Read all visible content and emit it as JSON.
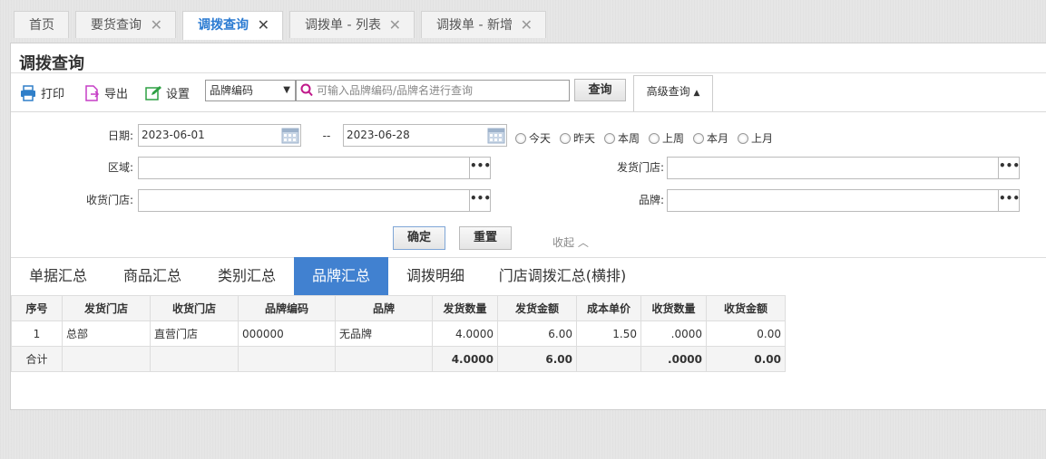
{
  "tabs": [
    {
      "label": "首页",
      "closable": false
    },
    {
      "label": "要货查询",
      "closable": true
    },
    {
      "label": "调拨查询",
      "closable": true,
      "active": true
    },
    {
      "label": "调拨单 - 列表",
      "closable": true
    },
    {
      "label": "调拨单 - 新增",
      "closable": true
    }
  ],
  "page_title": "调拨查询",
  "toolbar": {
    "print": "打印",
    "export": "导出",
    "settings": "设置",
    "search_field": "品牌编码",
    "search_placeholder": "可输入品牌编码/品牌名进行查询",
    "query": "查询",
    "advanced": "高级查询"
  },
  "filters": {
    "date_label": "日期:",
    "date_from": "2023-06-01",
    "date_sep": "--",
    "date_to": "2023-06-28",
    "quick_dates": [
      "今天",
      "昨天",
      "本周",
      "上周",
      "本月",
      "上月"
    ],
    "region_label": "区域:",
    "ship_store_label": "发货门店:",
    "recv_store_label": "收货门店:",
    "brand_label": "品牌:",
    "confirm": "确定",
    "reset": "重置",
    "collapse": "收起"
  },
  "summary_tabs": [
    "单据汇总",
    "商品汇总",
    "类别汇总",
    "品牌汇总",
    "调拨明细",
    "门店调拨汇总(横排)"
  ],
  "active_summary_tab": "品牌汇总",
  "table": {
    "headers": [
      "序号",
      "发货门店",
      "收货门店",
      "品牌编码",
      "品牌",
      "发货数量",
      "发货金额",
      "成本单价",
      "收货数量",
      "收货金额"
    ],
    "rows": [
      [
        "1",
        "总部",
        "直营门店",
        "000000",
        "无品牌",
        "4.0000",
        "6.00",
        "1.50",
        ".0000",
        "0.00"
      ]
    ],
    "total": [
      "合计",
      "",
      "",
      "",
      "",
      "4.0000",
      "6.00",
      "",
      ".0000",
      "0.00"
    ]
  },
  "colors": {
    "accent": "#4181d0",
    "active_tab_text": "#2b7bd2"
  }
}
